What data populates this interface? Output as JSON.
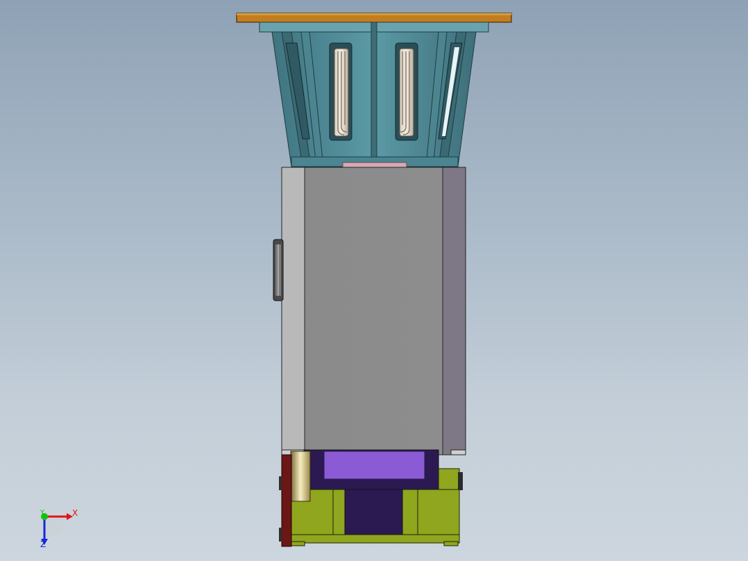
{
  "viewport": {
    "background_top": "#8fa2b5",
    "background_bottom": "#cdd6de"
  },
  "colors": {
    "top_plate": "#c07a1a",
    "fan_housing": "#4f8c98",
    "fan_housing_dark": "#2f5d66",
    "body_panel": "#8c8c8c",
    "body_side_left": "#b8b8b8",
    "body_side_right": "#7a7480",
    "purple_block": "#8a5cd6",
    "dark_purple": "#2a1a50",
    "green_base": "#8fa51e",
    "dark_red": "#6a1414",
    "axis_x": "#e01414",
    "axis_y": "#14c014",
    "axis_z": "#1428d8"
  },
  "triad": {
    "x_label": "X",
    "y_label": "Y",
    "z_label": "Z",
    "icon": "coordinate-triad-icon"
  }
}
